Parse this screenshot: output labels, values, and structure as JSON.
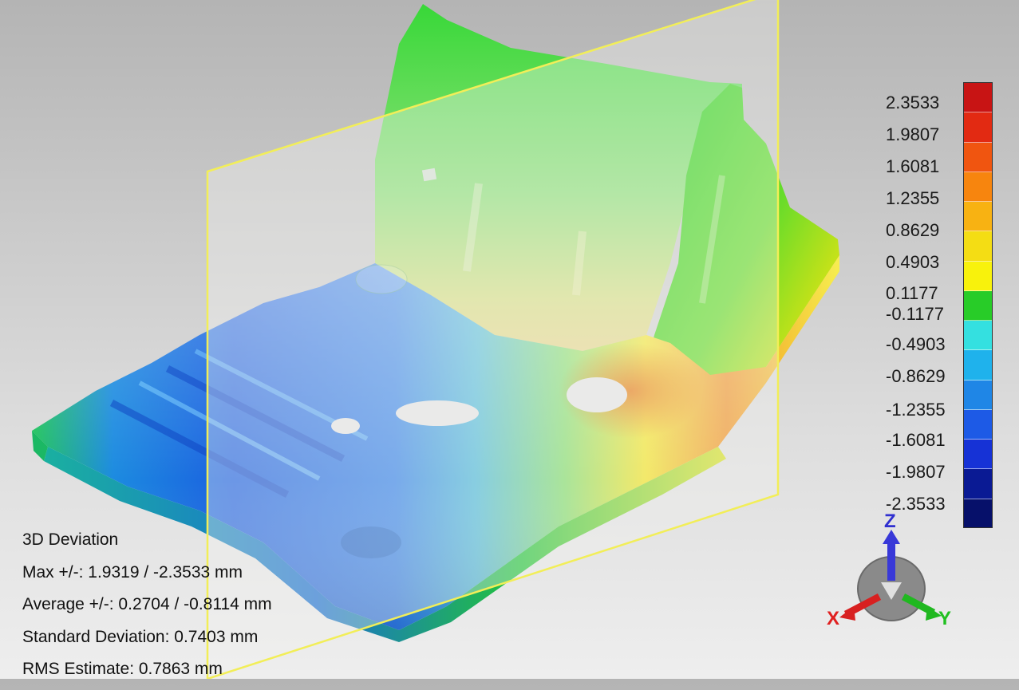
{
  "legend": {
    "labels": [
      "2.3533",
      "1.9807",
      "1.6081",
      "1.2355",
      "0.8629",
      "0.4903",
      "0.1177",
      "-0.1177",
      "-0.4903",
      "-0.8629",
      "-1.2355",
      "-1.6081",
      "-1.9807",
      "-2.3533"
    ],
    "colors": [
      "#c81414",
      "#e22a12",
      "#f05510",
      "#f7850e",
      "#f8b212",
      "#f4dd14",
      "#f8f20c",
      "#28cc28",
      "#34e0e0",
      "#1fb2ec",
      "#1f86e6",
      "#1d5ae6",
      "#1632d6",
      "#0a1a94",
      "#06106a"
    ]
  },
  "stats": {
    "title": "3D Deviation",
    "max": "Max +/-: 1.9319 / -2.3533 mm",
    "average": "Average +/-: 0.2704 / -0.8114 mm",
    "std_dev": "Standard Deviation: 0.7403 mm",
    "rms": "RMS Estimate: 0.7863 mm"
  },
  "triad": {
    "z": "Z",
    "x": "X",
    "y": "Y",
    "colors": {
      "x": "#e02020",
      "y": "#20c020",
      "z": "#3030d0"
    }
  }
}
